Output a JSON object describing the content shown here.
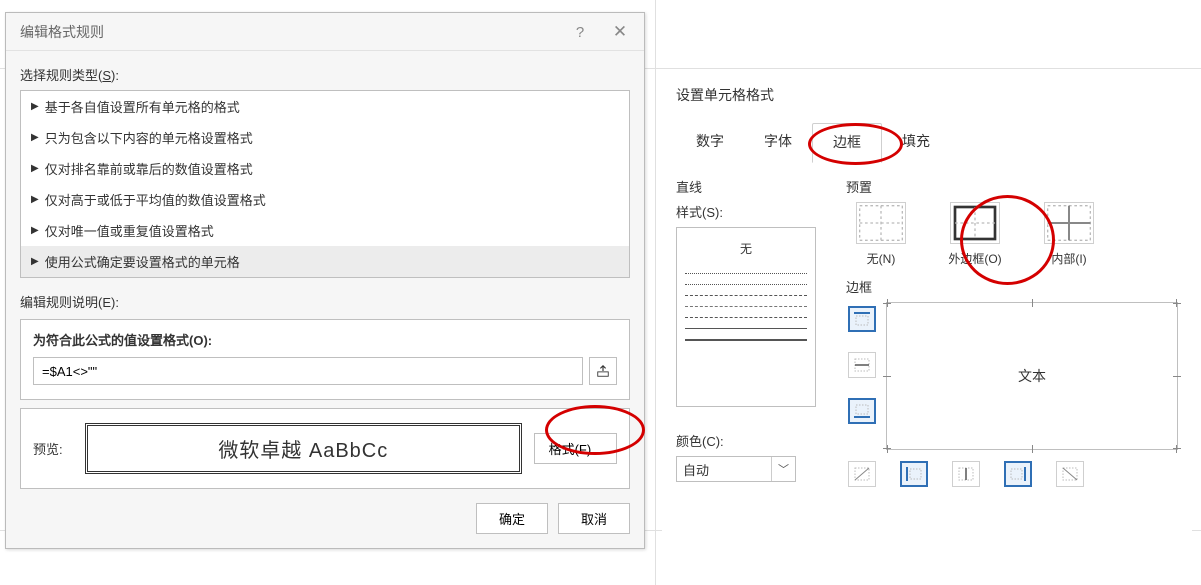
{
  "dialog1": {
    "title": "编辑格式规则",
    "select_label_prefix": "选择规则类型(",
    "select_label_key": "S",
    "select_label_suffix": "):",
    "rules": [
      "基于各自值设置所有单元格的格式",
      "只为包含以下内容的单元格设置格式",
      "仅对排名靠前或靠后的数值设置格式",
      "仅对高于或低于平均值的数值设置格式",
      "仅对唯一值或重复值设置格式",
      "使用公式确定要设置格式的单元格"
    ],
    "selected_rule_index": 5,
    "desc_label_prefix": "编辑规则说明(",
    "desc_label_key": "E",
    "desc_label_suffix": "):",
    "formula_label": "为符合此公式的值设置格式(O):",
    "formula_value": "=$A1<>\"\"",
    "preview_label": "预览:",
    "preview_text": "微软卓越 AaBbCc",
    "format_btn": "格式(F)...",
    "ok": "确定",
    "cancel": "取消"
  },
  "panel2": {
    "title": "设置单元格格式",
    "tabs": [
      "数字",
      "字体",
      "边框",
      "填充"
    ],
    "active_tab_index": 2,
    "line_group": "直线",
    "style_label": "样式(S):",
    "style_none": "无",
    "color_label": "颜色(C):",
    "color_value": "自动",
    "preset_label": "预置",
    "presets": [
      {
        "label": "无(N)"
      },
      {
        "label": "外边框(O)"
      },
      {
        "label": "内部(I)"
      }
    ],
    "border_label": "边框",
    "preview_text": "文本"
  }
}
